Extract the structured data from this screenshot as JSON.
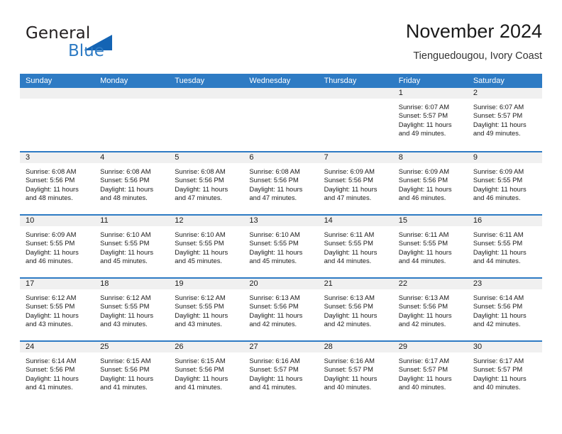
{
  "brand": {
    "line1": "General",
    "line2": "Blue",
    "triangle_color": "#1464b4",
    "blue_text_color": "#2e7bc4"
  },
  "header": {
    "title": "November 2024",
    "subtitle": "Tienguedougou, Ivory Coast",
    "accent_color": "#2e7bc4",
    "daynum_band_color": "#f0f0f0"
  },
  "weekdays": [
    "Sunday",
    "Monday",
    "Tuesday",
    "Wednesday",
    "Thursday",
    "Friday",
    "Saturday"
  ],
  "weeks": [
    [
      {
        "day": "",
        "empty": true
      },
      {
        "day": "",
        "empty": true
      },
      {
        "day": "",
        "empty": true
      },
      {
        "day": "",
        "empty": true
      },
      {
        "day": "",
        "empty": true
      },
      {
        "day": "1",
        "sunrise": "Sunrise: 6:07 AM",
        "sunset": "Sunset: 5:57 PM",
        "daylight1": "Daylight: 11 hours",
        "daylight2": "and 49 minutes."
      },
      {
        "day": "2",
        "sunrise": "Sunrise: 6:07 AM",
        "sunset": "Sunset: 5:57 PM",
        "daylight1": "Daylight: 11 hours",
        "daylight2": "and 49 minutes."
      }
    ],
    [
      {
        "day": "3",
        "sunrise": "Sunrise: 6:08 AM",
        "sunset": "Sunset: 5:56 PM",
        "daylight1": "Daylight: 11 hours",
        "daylight2": "and 48 minutes."
      },
      {
        "day": "4",
        "sunrise": "Sunrise: 6:08 AM",
        "sunset": "Sunset: 5:56 PM",
        "daylight1": "Daylight: 11 hours",
        "daylight2": "and 48 minutes."
      },
      {
        "day": "5",
        "sunrise": "Sunrise: 6:08 AM",
        "sunset": "Sunset: 5:56 PM",
        "daylight1": "Daylight: 11 hours",
        "daylight2": "and 47 minutes."
      },
      {
        "day": "6",
        "sunrise": "Sunrise: 6:08 AM",
        "sunset": "Sunset: 5:56 PM",
        "daylight1": "Daylight: 11 hours",
        "daylight2": "and 47 minutes."
      },
      {
        "day": "7",
        "sunrise": "Sunrise: 6:09 AM",
        "sunset": "Sunset: 5:56 PM",
        "daylight1": "Daylight: 11 hours",
        "daylight2": "and 47 minutes."
      },
      {
        "day": "8",
        "sunrise": "Sunrise: 6:09 AM",
        "sunset": "Sunset: 5:56 PM",
        "daylight1": "Daylight: 11 hours",
        "daylight2": "and 46 minutes."
      },
      {
        "day": "9",
        "sunrise": "Sunrise: 6:09 AM",
        "sunset": "Sunset: 5:55 PM",
        "daylight1": "Daylight: 11 hours",
        "daylight2": "and 46 minutes."
      }
    ],
    [
      {
        "day": "10",
        "sunrise": "Sunrise: 6:09 AM",
        "sunset": "Sunset: 5:55 PM",
        "daylight1": "Daylight: 11 hours",
        "daylight2": "and 46 minutes."
      },
      {
        "day": "11",
        "sunrise": "Sunrise: 6:10 AM",
        "sunset": "Sunset: 5:55 PM",
        "daylight1": "Daylight: 11 hours",
        "daylight2": "and 45 minutes."
      },
      {
        "day": "12",
        "sunrise": "Sunrise: 6:10 AM",
        "sunset": "Sunset: 5:55 PM",
        "daylight1": "Daylight: 11 hours",
        "daylight2": "and 45 minutes."
      },
      {
        "day": "13",
        "sunrise": "Sunrise: 6:10 AM",
        "sunset": "Sunset: 5:55 PM",
        "daylight1": "Daylight: 11 hours",
        "daylight2": "and 45 minutes."
      },
      {
        "day": "14",
        "sunrise": "Sunrise: 6:11 AM",
        "sunset": "Sunset: 5:55 PM",
        "daylight1": "Daylight: 11 hours",
        "daylight2": "and 44 minutes."
      },
      {
        "day": "15",
        "sunrise": "Sunrise: 6:11 AM",
        "sunset": "Sunset: 5:55 PM",
        "daylight1": "Daylight: 11 hours",
        "daylight2": "and 44 minutes."
      },
      {
        "day": "16",
        "sunrise": "Sunrise: 6:11 AM",
        "sunset": "Sunset: 5:55 PM",
        "daylight1": "Daylight: 11 hours",
        "daylight2": "and 44 minutes."
      }
    ],
    [
      {
        "day": "17",
        "sunrise": "Sunrise: 6:12 AM",
        "sunset": "Sunset: 5:55 PM",
        "daylight1": "Daylight: 11 hours",
        "daylight2": "and 43 minutes."
      },
      {
        "day": "18",
        "sunrise": "Sunrise: 6:12 AM",
        "sunset": "Sunset: 5:55 PM",
        "daylight1": "Daylight: 11 hours",
        "daylight2": "and 43 minutes."
      },
      {
        "day": "19",
        "sunrise": "Sunrise: 6:12 AM",
        "sunset": "Sunset: 5:55 PM",
        "daylight1": "Daylight: 11 hours",
        "daylight2": "and 43 minutes."
      },
      {
        "day": "20",
        "sunrise": "Sunrise: 6:13 AM",
        "sunset": "Sunset: 5:56 PM",
        "daylight1": "Daylight: 11 hours",
        "daylight2": "and 42 minutes."
      },
      {
        "day": "21",
        "sunrise": "Sunrise: 6:13 AM",
        "sunset": "Sunset: 5:56 PM",
        "daylight1": "Daylight: 11 hours",
        "daylight2": "and 42 minutes."
      },
      {
        "day": "22",
        "sunrise": "Sunrise: 6:13 AM",
        "sunset": "Sunset: 5:56 PM",
        "daylight1": "Daylight: 11 hours",
        "daylight2": "and 42 minutes."
      },
      {
        "day": "23",
        "sunrise": "Sunrise: 6:14 AM",
        "sunset": "Sunset: 5:56 PM",
        "daylight1": "Daylight: 11 hours",
        "daylight2": "and 42 minutes."
      }
    ],
    [
      {
        "day": "24",
        "sunrise": "Sunrise: 6:14 AM",
        "sunset": "Sunset: 5:56 PM",
        "daylight1": "Daylight: 11 hours",
        "daylight2": "and 41 minutes."
      },
      {
        "day": "25",
        "sunrise": "Sunrise: 6:15 AM",
        "sunset": "Sunset: 5:56 PM",
        "daylight1": "Daylight: 11 hours",
        "daylight2": "and 41 minutes."
      },
      {
        "day": "26",
        "sunrise": "Sunrise: 6:15 AM",
        "sunset": "Sunset: 5:56 PM",
        "daylight1": "Daylight: 11 hours",
        "daylight2": "and 41 minutes."
      },
      {
        "day": "27",
        "sunrise": "Sunrise: 6:16 AM",
        "sunset": "Sunset: 5:57 PM",
        "daylight1": "Daylight: 11 hours",
        "daylight2": "and 41 minutes."
      },
      {
        "day": "28",
        "sunrise": "Sunrise: 6:16 AM",
        "sunset": "Sunset: 5:57 PM",
        "daylight1": "Daylight: 11 hours",
        "daylight2": "and 40 minutes."
      },
      {
        "day": "29",
        "sunrise": "Sunrise: 6:17 AM",
        "sunset": "Sunset: 5:57 PM",
        "daylight1": "Daylight: 11 hours",
        "daylight2": "and 40 minutes."
      },
      {
        "day": "30",
        "sunrise": "Sunrise: 6:17 AM",
        "sunset": "Sunset: 5:57 PM",
        "daylight1": "Daylight: 11 hours",
        "daylight2": "and 40 minutes."
      }
    ]
  ]
}
